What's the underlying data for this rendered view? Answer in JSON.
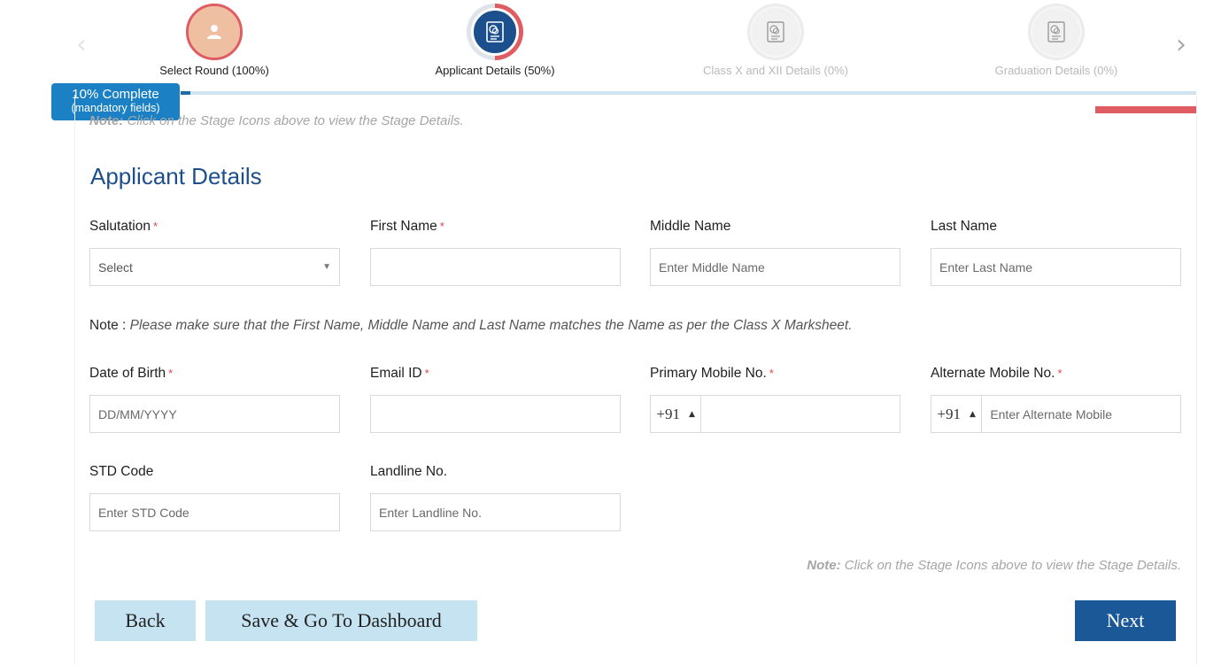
{
  "stepper": {
    "steps": [
      {
        "label": "Select Round (100%)",
        "icon": "user-icon",
        "state": "done"
      },
      {
        "label": "Applicant Details (50%)",
        "icon": "document-icon",
        "state": "active"
      },
      {
        "label": "Class X and XII Details (0%)",
        "icon": "document-icon",
        "state": "pending"
      },
      {
        "label": "Graduation Details (0%)",
        "icon": "document-icon",
        "state": "pending"
      }
    ],
    "prev_arrow": "‹",
    "next_arrow": "›"
  },
  "progress": {
    "percent_label": "10% Complete",
    "sub_label": "(mandatory fields)",
    "fraction": 0.01
  },
  "notes": {
    "top_bold": "Note:",
    "top_text": " Click on the Stage Icons above to view the Stage Details.",
    "bottom_bold": "Note:",
    "bottom_text": " Click on the Stage Icons above to view the Stage Details.",
    "name_label": "Note : ",
    "name_text": "Please make sure that the First Name, Middle Name and Last Name matches the Name as per the Class X Marksheet."
  },
  "form": {
    "title": "Applicant Details",
    "required_mark": "*",
    "salutation": {
      "label": "Salutation",
      "value": "Select"
    },
    "first_name": {
      "label": "First Name",
      "placeholder": ""
    },
    "middle_name": {
      "label": "Middle Name",
      "placeholder": "Enter Middle Name"
    },
    "last_name": {
      "label": "Last Name",
      "placeholder": "Enter Last Name"
    },
    "dob": {
      "label": "Date of Birth",
      "placeholder": "DD/MM/YYYY"
    },
    "email": {
      "label": "Email ID",
      "placeholder": ""
    },
    "primary_mobile": {
      "label": "Primary Mobile No.",
      "country_code": "+91",
      "placeholder": ""
    },
    "alternate_mobile": {
      "label": "Alternate Mobile No.",
      "country_code": "+91",
      "placeholder": "Enter Alternate Mobile"
    },
    "std_code": {
      "label": "STD Code",
      "placeholder": "Enter STD Code"
    },
    "landline": {
      "label": "Landline No.",
      "placeholder": "Enter Landline No."
    }
  },
  "buttons": {
    "back": "Back",
    "save": "Save & Go To Dashboard",
    "next": "Next"
  },
  "colors": {
    "brand_blue": "#1b4f8d",
    "badge_blue": "#1b80c4",
    "accent_red": "#e05c63",
    "button_light": "#c5e3f0"
  }
}
